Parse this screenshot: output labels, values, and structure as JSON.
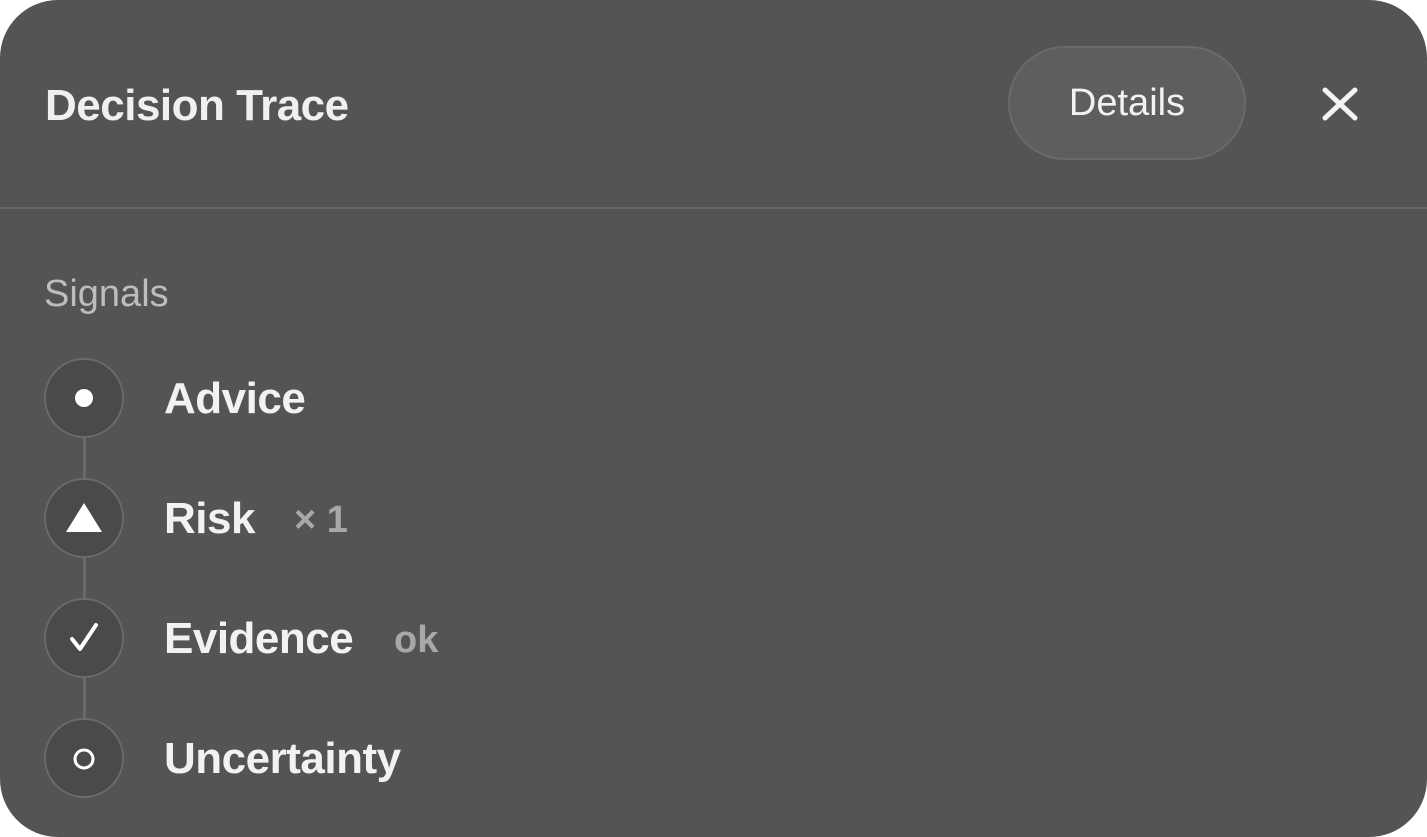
{
  "header": {
    "title": "Decision Trace",
    "details_label": "Details",
    "close_icon": "close-icon"
  },
  "signals": {
    "section_label": "Signals",
    "items": [
      {
        "label": "Advice",
        "meta": "",
        "icon": "dot-icon"
      },
      {
        "label": "Risk",
        "meta": "× 1",
        "icon": "triangle-icon"
      },
      {
        "label": "Evidence",
        "meta": "ok",
        "icon": "check-icon"
      },
      {
        "label": "Uncertainty",
        "meta": "",
        "icon": "ring-icon"
      }
    ]
  },
  "colors": {
    "panel_background": "#545454",
    "text_primary": "#f2f2f2",
    "text_secondary": "#bdbdbd",
    "text_meta": "#a8a8a8"
  }
}
